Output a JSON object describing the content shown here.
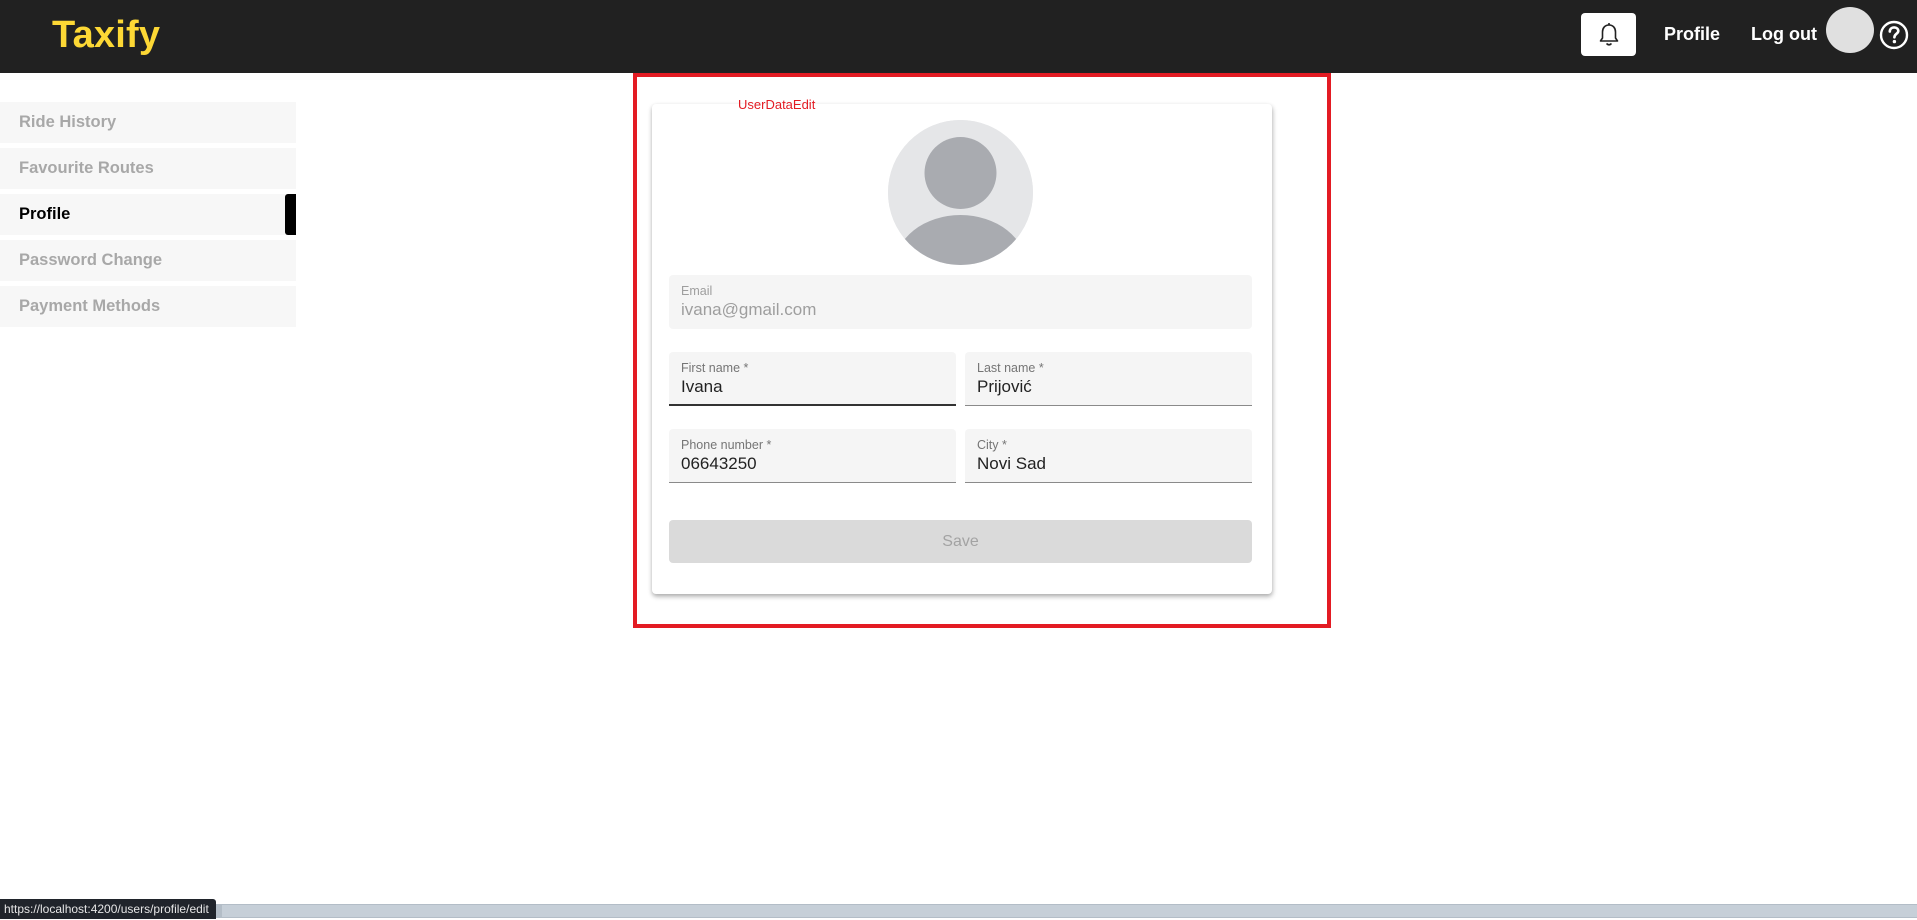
{
  "app": {
    "brand": "Taxify"
  },
  "header": {
    "bell_icon": "bell-icon",
    "profile_label": "Profile",
    "logout_label": "Log out",
    "help_icon": "question-circle-icon"
  },
  "sidebar": {
    "items": [
      {
        "label": "Ride History",
        "active": false
      },
      {
        "label": "Favourite Routes",
        "active": false
      },
      {
        "label": "Profile",
        "active": true
      },
      {
        "label": "Password Change",
        "active": false
      },
      {
        "label": "Payment Methods",
        "active": false
      }
    ]
  },
  "highlight": {
    "label": "UserDataEdit",
    "color": "#e31b23"
  },
  "form": {
    "email": {
      "label": "Email",
      "value": "ivana@gmail.com"
    },
    "first_name": {
      "label": "First name *",
      "value": "Ivana"
    },
    "last_name": {
      "label": "Last name *",
      "value": "Prijović"
    },
    "phone": {
      "label": "Phone number *",
      "value": "06643250"
    },
    "city": {
      "label": "City *",
      "value": "Novi Sad"
    },
    "save_label": "Save"
  },
  "status_bar": {
    "url": "https://localhost:4200/users/profile/edit"
  },
  "colors": {
    "brand": "#fdd835",
    "topbar": "#212121"
  }
}
